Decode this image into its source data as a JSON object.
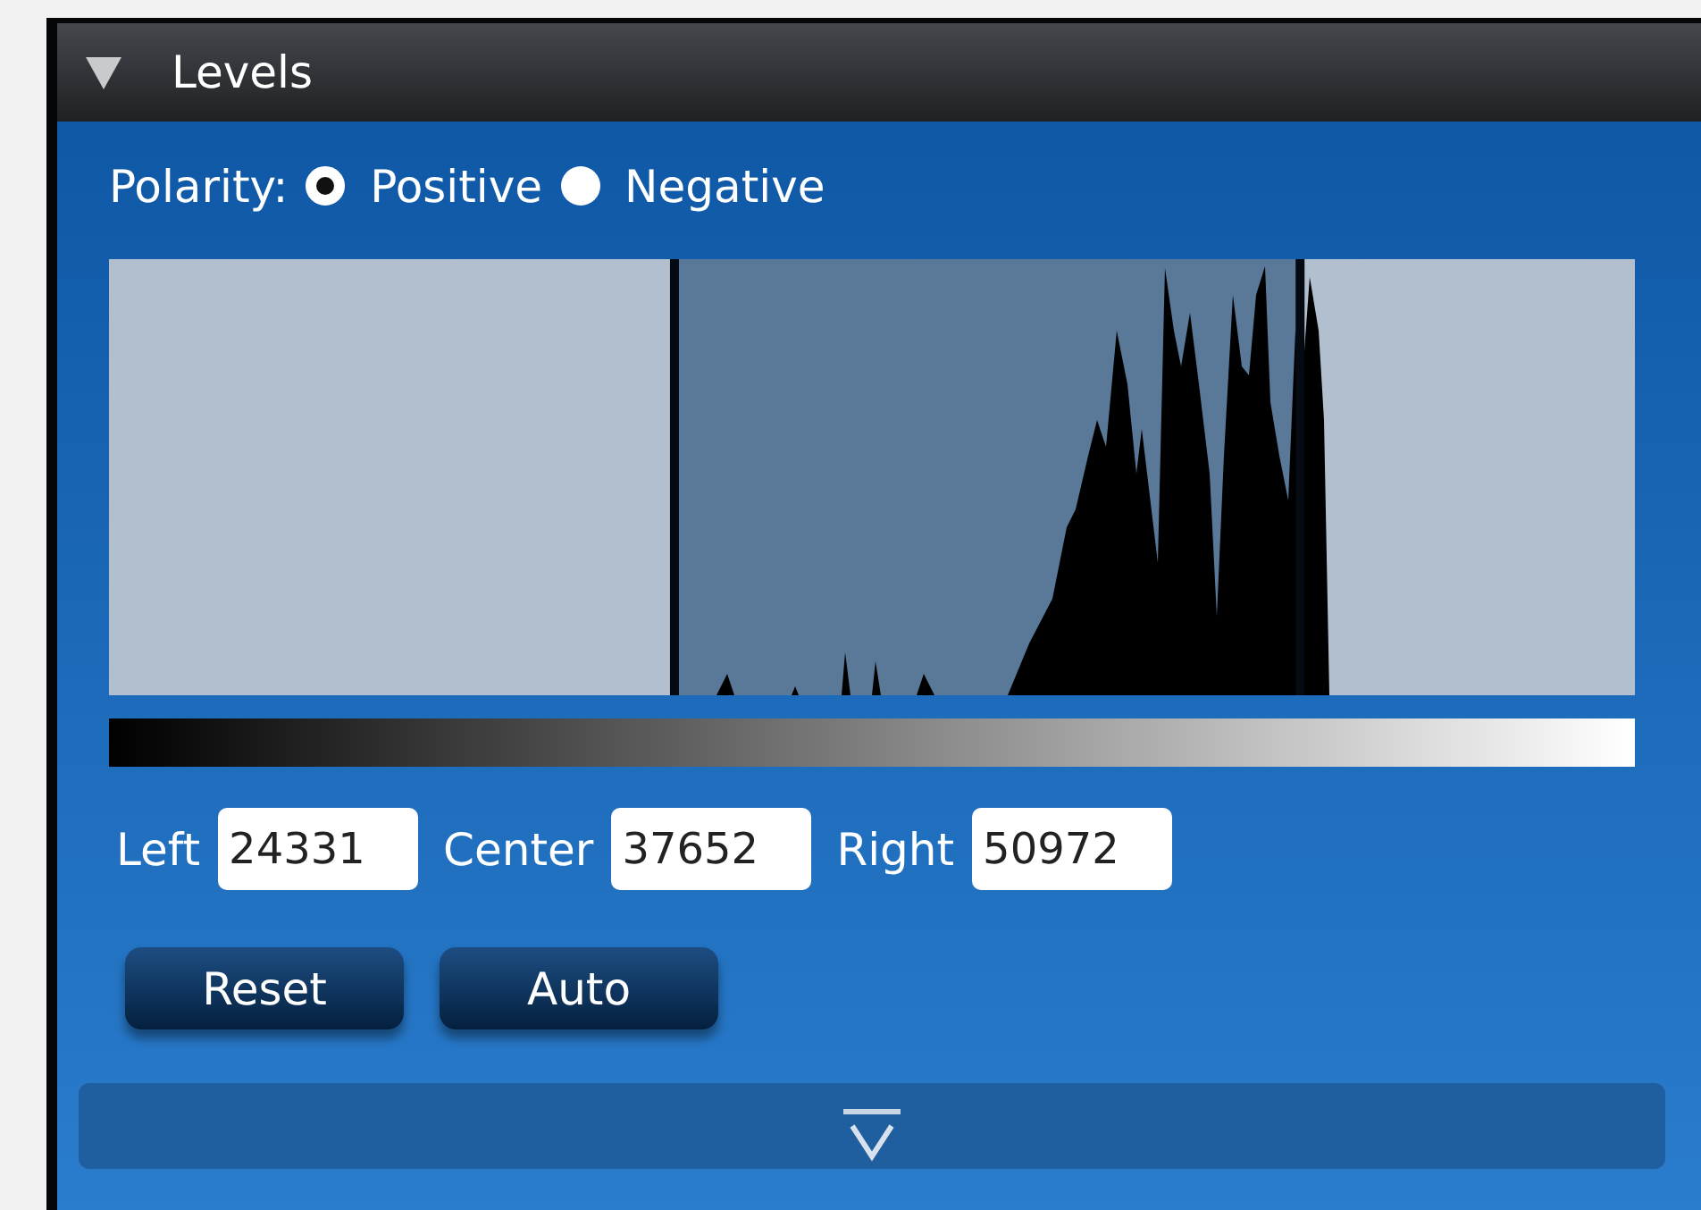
{
  "panel": {
    "title": "Levels",
    "expanded": true
  },
  "polarity": {
    "label": "Polarity:",
    "options": [
      {
        "label": "Positive",
        "selected": true
      },
      {
        "label": "Negative",
        "selected": false
      }
    ]
  },
  "histogram": {
    "left_marker": {
      "level": 0.37
    },
    "right_marker": {
      "level": 0.78
    }
  },
  "fields": [
    {
      "label": "Left",
      "value": "24331"
    },
    {
      "label": "Center",
      "value": "37652"
    },
    {
      "label": "Right",
      "value": "50972"
    }
  ],
  "buttons": [
    "Reset",
    "Auto"
  ]
}
